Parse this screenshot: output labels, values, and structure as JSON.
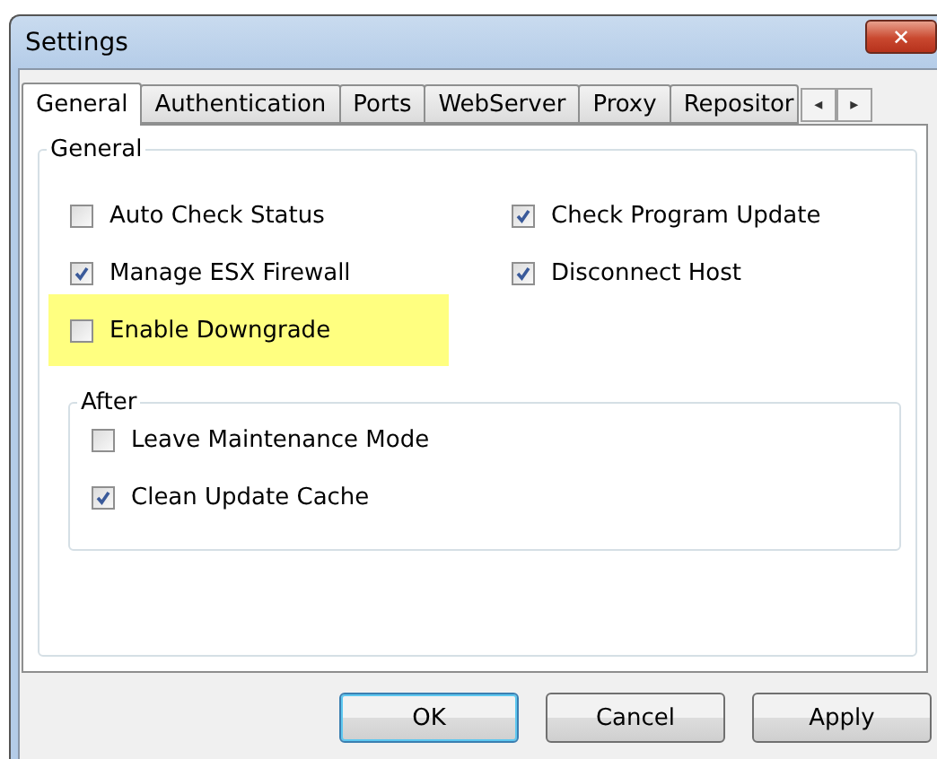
{
  "window": {
    "title": "Settings",
    "close": "✕"
  },
  "tabs": [
    {
      "label": "General",
      "selected": true
    },
    {
      "label": "Authentication",
      "selected": false
    },
    {
      "label": "Ports",
      "selected": false
    },
    {
      "label": "WebServer",
      "selected": false
    },
    {
      "label": "Proxy",
      "selected": false
    },
    {
      "label": "Repositor",
      "selected": false
    }
  ],
  "tab_scroll": [
    "◂",
    "▸"
  ],
  "general_group": {
    "title": "General",
    "options": [
      {
        "label": "Auto Check Status",
        "checked": false,
        "highlighted": false
      },
      {
        "label": "Check Program Update",
        "checked": true,
        "highlighted": false
      },
      {
        "label": "Manage ESX Firewall",
        "checked": true,
        "highlighted": false
      },
      {
        "label": "Disconnect Host",
        "checked": true,
        "highlighted": false
      },
      {
        "label": "Enable Downgrade",
        "checked": false,
        "highlighted": true
      }
    ]
  },
  "after_group": {
    "title": "After",
    "options": [
      {
        "label": "Leave Maintenance Mode",
        "checked": false
      },
      {
        "label": "Clean Update Cache",
        "checked": true
      }
    ]
  },
  "buttons": [
    {
      "label": "OK",
      "default": true
    },
    {
      "label": "Cancel",
      "default": false
    },
    {
      "label": "Apply",
      "default": false
    }
  ]
}
